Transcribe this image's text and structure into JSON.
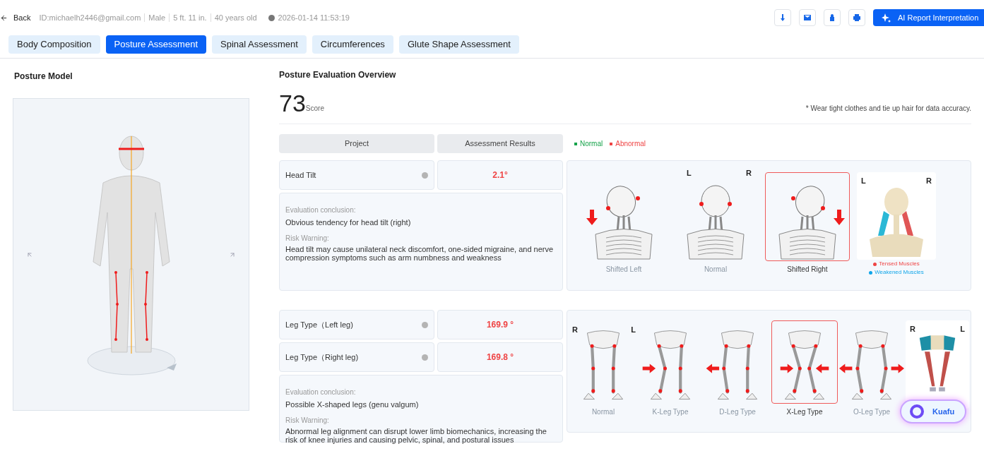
{
  "header": {
    "back": "Back",
    "meta": [
      "ID:michaelh2446@gmail.com",
      "Male",
      "5 ft. 11 in.",
      "40 years old"
    ],
    "timestamp": "2026-01-14 11:53:19",
    "ai_button": "AI Report Interpretation"
  },
  "tabs": [
    {
      "label": "Body Composition",
      "selected": false
    },
    {
      "label": "Posture Assessment",
      "selected": true
    },
    {
      "label": "Spinal Assessment",
      "selected": false
    },
    {
      "label": "Circumferences",
      "selected": false
    },
    {
      "label": "Glute Shape Assessment",
      "selected": false
    }
  ],
  "posture_model": {
    "title": "Posture Model"
  },
  "overview": {
    "title": "Posture Evaluation Overview",
    "score": "73",
    "score_label": "Score",
    "note": "* Wear tight clothes and tie up hair for data accuracy."
  },
  "table_header": [
    "Project",
    "Assessment Results"
  ],
  "legend": [
    {
      "label": "Normal",
      "color": "#16a34a"
    },
    {
      "label": "Abnormal",
      "color": "#ef4444"
    }
  ],
  "sections": [
    {
      "kind": "neck",
      "measures": [
        {
          "label": "Head Tilt",
          "value": "2.1°",
          "abnormal": true
        }
      ],
      "conclusion_label": "Evaluation conclusion:",
      "conclusion": "Obvious tendency for head tilt (right)",
      "risk_label": "Risk Warning:",
      "risk": "Head tilt may cause unilateral neck discomfort, one-sided migraine, and nerve compression symptoms such as arm numbness and weakness",
      "side_labels": [
        "L",
        "R"
      ],
      "options": [
        {
          "kind": "left",
          "label": "Shifted Left",
          "selected": false
        },
        {
          "kind": "normal",
          "label": "Normal",
          "selected": false
        },
        {
          "kind": "right",
          "label": "Shifted Right",
          "selected": true
        }
      ],
      "muscles": {
        "side_labels": [
          "L",
          "R"
        ],
        "legend": [
          {
            "label": "Tensed Muscles",
            "color": "#ef4444"
          },
          {
            "label": "Weakened Muscles",
            "color": "#0ea5e9"
          }
        ]
      }
    },
    {
      "kind": "legs",
      "measures": [
        {
          "label": "Leg Type（Left leg)",
          "value": "169.9 °",
          "abnormal": true
        },
        {
          "label": "Leg Type（Right leg)",
          "value": "169.8 °",
          "abnormal": true
        }
      ],
      "conclusion_label": "Evaluation conclusion:",
      "conclusion": "Possible X-shaped legs (genu valgum)",
      "risk_label": "Risk Warning:",
      "risk": "Abnormal leg alignment can disrupt lower limb biomechanics, increasing the risk of knee injuries and causing pelvic, spinal, and postural issues",
      "side_labels": [
        "R",
        "L"
      ],
      "options": [
        {
          "kind": "normal",
          "label": "Normal",
          "selected": false
        },
        {
          "kind": "k",
          "label": "K-Leg Type",
          "selected": false
        },
        {
          "kind": "d",
          "label": "D-Leg Type",
          "selected": false
        },
        {
          "kind": "x",
          "label": "X-Leg Type",
          "selected": true
        },
        {
          "kind": "o",
          "label": "O-Leg Type",
          "selected": false
        }
      ],
      "muscles": {
        "side_labels": [
          "R",
          "L"
        ]
      }
    }
  ],
  "assistant": {
    "label": "Kuafu"
  }
}
